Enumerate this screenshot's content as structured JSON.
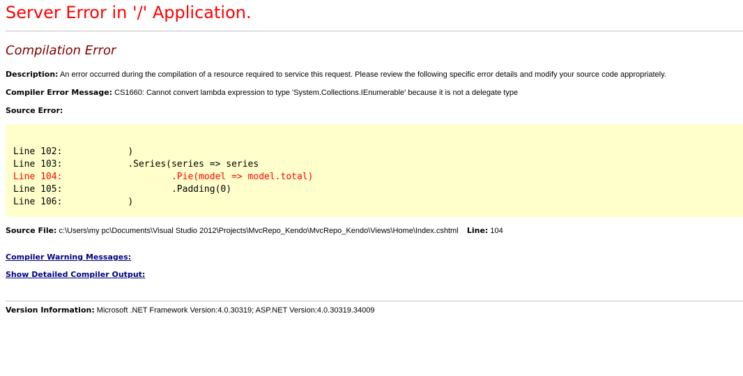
{
  "colors": {
    "title": "#ff0000",
    "section_title": "#800000",
    "code_background": "#ffffcc",
    "error_line": "#ff0000",
    "link": "#000080",
    "rule": "#c0c0c0"
  },
  "header": {
    "title": "Server Error in '/' Application."
  },
  "error": {
    "heading": "Compilation Error",
    "description_label": "Description:",
    "description_text": "An error occurred during the compilation of a resource required to service this request. Please review the following specific error details and modify your source code appropriately.",
    "message_label": "Compiler Error Message:",
    "message_text": "CS1660: Cannot convert lambda expression to type 'System.Collections.IEnumerable' because it is not a delegate type",
    "source_error_label": "Source Error:"
  },
  "source_code": {
    "lines": [
      {
        "text": "Line 102:            )",
        "is_error": false
      },
      {
        "text": "Line 103:            .Series(series => series",
        "is_error": false
      },
      {
        "text": "Line 104:                    .Pie(model => model.total)",
        "is_error": true
      },
      {
        "text": "Line 105:                    .Padding(0)",
        "is_error": false
      },
      {
        "text": "Line 106:            )",
        "is_error": false
      }
    ]
  },
  "source_file": {
    "label": "Source File:",
    "path": "c:\\Users\\my pc\\Documents\\Visual Studio 2012\\Projects\\MvcRepo_Kendo\\MvcRepo_Kendo\\Views\\Home\\Index.cshtml",
    "line_label": "Line:",
    "line_number": "104"
  },
  "links": {
    "warnings": "Compiler Warning Messages:",
    "detailed_output": "Show Detailed Compiler Output:"
  },
  "version": {
    "label": "Version Information:",
    "text": "Microsoft .NET Framework Version:4.0.30319; ASP.NET Version:4.0.30319.34009"
  }
}
